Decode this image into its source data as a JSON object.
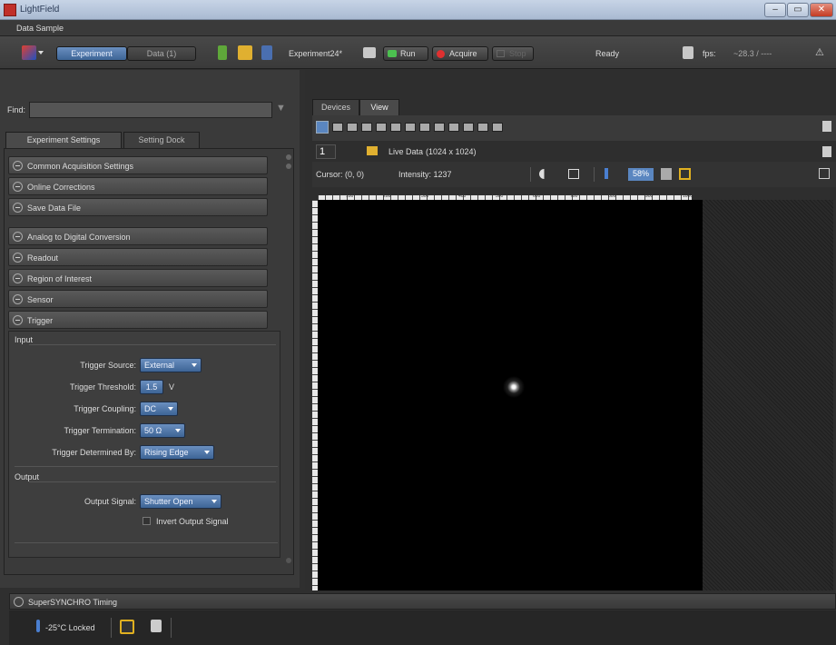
{
  "window": {
    "title": "LightField",
    "min": "–",
    "max": "▭",
    "close": "✕"
  },
  "datasample": "Data Sample",
  "toolbar": {
    "view_tabs": [
      "Experiment",
      "Data (1)"
    ],
    "experiment_name": "Experiment24*",
    "run_label": "Run",
    "acquire_label": "Acquire",
    "stop_label": "Stop",
    "status": "Ready",
    "fps_label": "fps:",
    "fps_value": "~28.3 / ----"
  },
  "left": {
    "find_label": "Find:",
    "find_value": "",
    "tabs": [
      "Experiment Settings",
      "Setting Dock"
    ],
    "sections_top": [
      "Common Acquisition Settings",
      "Online Corrections",
      "Save Data File"
    ],
    "sections_mid": [
      "Analog to Digital Conversion",
      "Readout",
      "Region of Interest",
      "Sensor",
      "Trigger"
    ],
    "input_heading": "Input",
    "trigger": {
      "source_label": "Trigger Source:",
      "source_value": "External",
      "threshold_label": "Trigger Threshold:",
      "threshold_value": "1.5",
      "threshold_unit": "V",
      "coupling_label": "Trigger Coupling:",
      "coupling_value": "DC",
      "termination_label": "Trigger Termination:",
      "termination_value": "50 Ω",
      "determined_label": "Trigger Determined By:",
      "determined_value": "Rising Edge"
    },
    "output_heading": "Output",
    "output": {
      "signal_label": "Output Signal:",
      "signal_value": "Shutter Open",
      "invert_label": "Invert Output Signal"
    }
  },
  "bottom": {
    "section": "SuperSYNCHRO Timing",
    "temp": "-25°C Locked"
  },
  "right": {
    "tabs": [
      "Devices",
      "View"
    ],
    "frame_index": "1",
    "data_label": "Live Data",
    "dims": "(1024 x 1024)",
    "cursor": "Cursor: (0, 0)",
    "intensity": "Intensity: 1237",
    "zoom": "58%",
    "ruler_ticks": [
      "100",
      "200",
      "300",
      "400",
      "500",
      "600",
      "700",
      "800",
      "900",
      "1000"
    ]
  },
  "colors": {
    "accent": "#4a76ad",
    "background": "#2f2f2f"
  }
}
